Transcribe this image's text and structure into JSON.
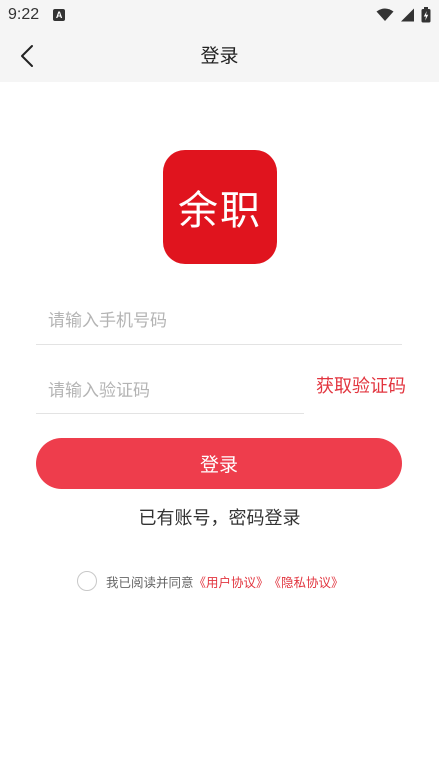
{
  "status_bar": {
    "time": "9:22",
    "notification_icon": "a-notification-icon",
    "wifi_icon": "wifi-icon",
    "signal_icon": "signal-icon",
    "battery_icon": "battery-icon"
  },
  "nav": {
    "back_icon": "chevron-left-icon",
    "title": "登录"
  },
  "logo": {
    "text": "余职",
    "color": "#e0141e"
  },
  "form": {
    "phone_placeholder": "请输入手机号码",
    "phone_value": "",
    "code_placeholder": "请输入验证码",
    "code_value": "",
    "get_code_label": "获取验证码",
    "login_label": "登录",
    "password_login_label": "已有账号，密码登录"
  },
  "agreement": {
    "checked": false,
    "text": "我已阅读并同意",
    "user_agreement": "《用户协议》",
    "privacy_policy": "《隐私协议》"
  },
  "colors": {
    "accent": "#ee3d4c",
    "link": "#e2353f",
    "header_bg": "#f5f5f5"
  }
}
